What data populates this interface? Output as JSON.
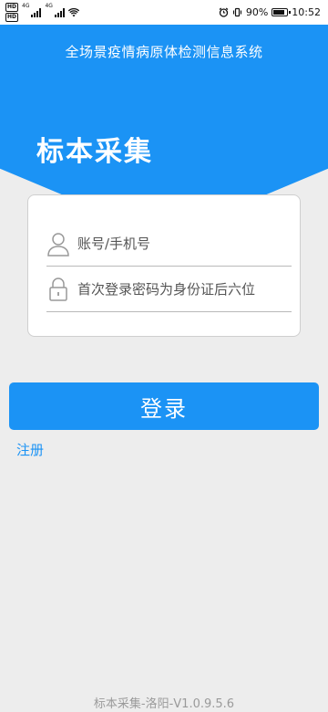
{
  "status_bar": {
    "hd1": "HD",
    "hd2": "HD",
    "net1": "4G",
    "net2": "4G",
    "battery_pct": "90%",
    "time": "10:52",
    "battery_level": 0.9
  },
  "header": {
    "title": "全场景疫情病原体检测信息系统"
  },
  "hero": {
    "title": "标本采集"
  },
  "form": {
    "account_placeholder": "账号/手机号",
    "password_placeholder": "首次登录密码为身份证后六位"
  },
  "actions": {
    "login_label": "登录",
    "register_label": "注册"
  },
  "footer": {
    "version": "标本采集-洛阳-V1.0.9.5.6"
  },
  "colors": {
    "primary": "#1b93f5",
    "background": "#ededed"
  },
  "icons": {
    "account": "user-icon",
    "password": "lock-icon"
  }
}
